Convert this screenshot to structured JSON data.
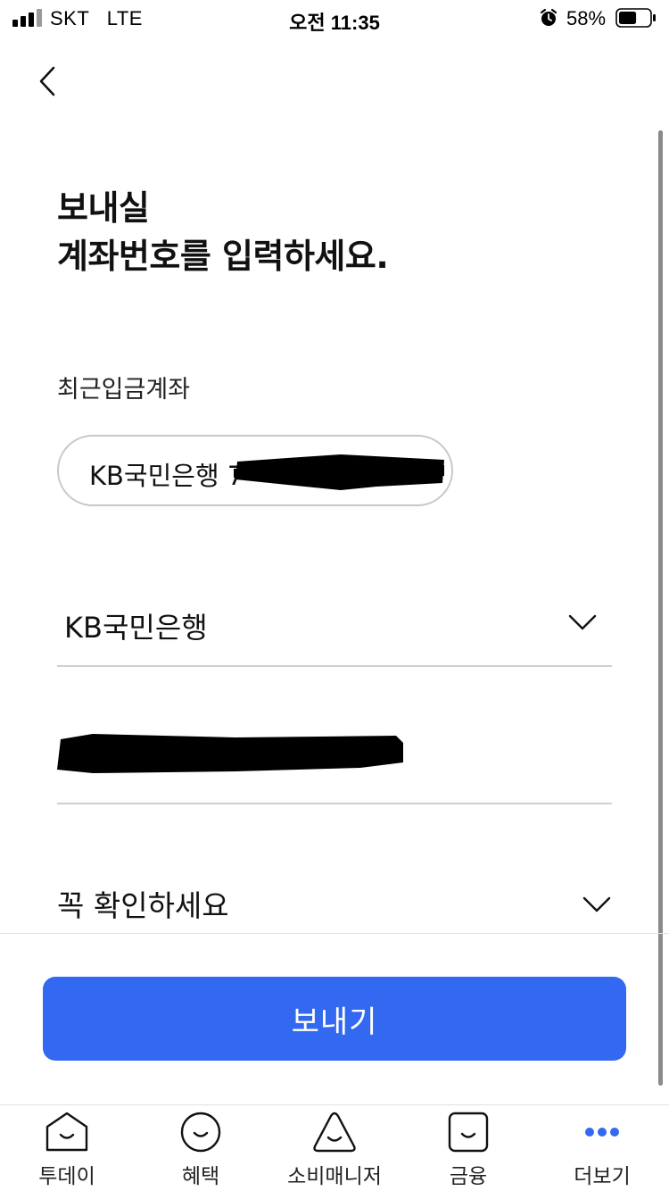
{
  "status_bar": {
    "carrier": "SKT   LTE",
    "time": "오전 11:35",
    "battery_percent": "58%",
    "battery_level": 0.58,
    "icons": [
      "signal-icon",
      "alarm-icon",
      "battery-icon"
    ]
  },
  "header": {
    "back_icon": "chevron-left-icon"
  },
  "page": {
    "title_line1": "보내실",
    "title_line2": "계좌번호를 입력하세요."
  },
  "recent": {
    "label": "최근입금계좌",
    "chip_text": "KB국민은행 7"
  },
  "form": {
    "bank_name": "KB국민은행",
    "bank_chevron_icon": "chevron-down-icon",
    "account_number": "",
    "confirm_label": "꼭 확인하세요",
    "confirm_chevron_icon": "chevron-down-icon"
  },
  "actions": {
    "send_label": "보내기"
  },
  "tab_bar": {
    "items": [
      {
        "label": "투데이",
        "icon": "home-face-icon"
      },
      {
        "label": "혜택",
        "icon": "circle-face-icon"
      },
      {
        "label": "소비매니저",
        "icon": "triangle-face-icon"
      },
      {
        "label": "금융",
        "icon": "square-face-icon"
      },
      {
        "label": "더보기",
        "icon": "more-dots-icon"
      }
    ]
  },
  "colors": {
    "accent": "#3269f0",
    "text": "#111111",
    "divider": "#cfcfcf"
  }
}
